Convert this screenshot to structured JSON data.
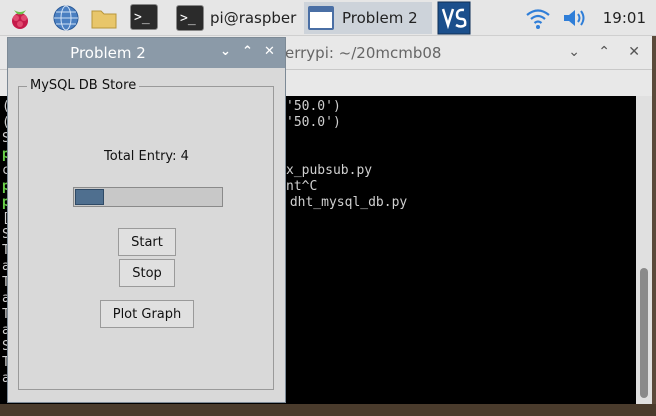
{
  "taskbar": {
    "terminal_button_label": "pi@raspber",
    "active_button_label": "Problem 2",
    "clock": "19:01"
  },
  "terminal": {
    "title": "errypi: ~/20mcmb08",
    "lines": [
      "'50.0')",
      "'50.0')",
      "x_pubsub.py",
      "nt^C",
      " dht_mysql_db.py"
    ],
    "left_col": [
      "(",
      "(",
      "S",
      "p",
      "c",
      "p",
      "p",
      "[",
      "S",
      "T",
      "a",
      "T",
      "a",
      "T",
      "a",
      "S",
      "T",
      "a"
    ]
  },
  "dialog": {
    "title": "Problem 2",
    "group_label": "MySQL DB Store",
    "total_entry": "Total Entry: 4",
    "progress_fraction": 0.2,
    "start_label": "Start",
    "stop_label": "Stop",
    "plot_label": "Plot Graph"
  },
  "colors": {
    "dialog_titlebar": "#8b9aa8",
    "progress_fill": "#4f6f8f",
    "taskbar": "#e6e6e6"
  }
}
